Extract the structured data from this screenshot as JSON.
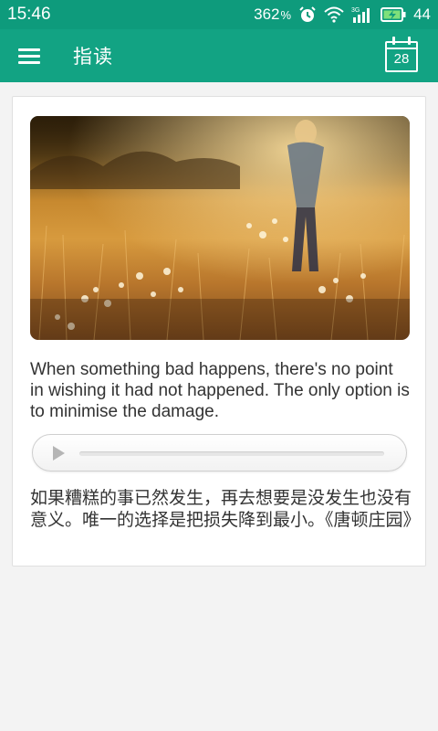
{
  "status_bar": {
    "time": "15:46",
    "speed_value": "362",
    "speed_unit": "%",
    "network_label": "3G",
    "battery_level": "44",
    "icons": [
      "alarm-icon",
      "wifi-icon",
      "signal-icon",
      "battery-charging-icon"
    ],
    "colors": {
      "background": "#0e9b7c"
    }
  },
  "app_bar": {
    "title": "指读",
    "menu_icon": "hamburger-menu-icon",
    "calendar_day": "28",
    "colors": {
      "background": "#12a383"
    }
  },
  "card": {
    "photo_description_icon": "photo-image",
    "english_sentence": "When something bad happens, there's no point in wishing it had not happened. The only option is to minimise the damage.",
    "audio_player": {
      "play_icon": "play-icon",
      "progress": 0
    },
    "chinese_translation": "如果糟糕的事已然发生，再去想要是没发生也没有意义。唯一的选择是把损失降到最小。《唐顿庄园》"
  }
}
